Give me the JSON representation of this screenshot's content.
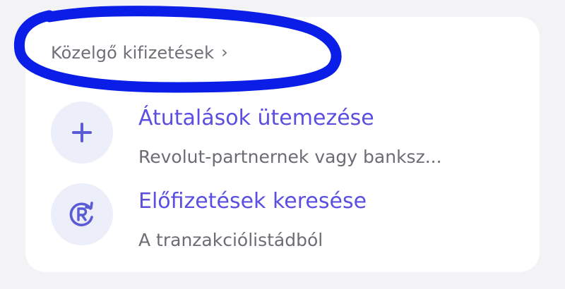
{
  "section": {
    "title": "Közelgő kifizetések",
    "chevron": "›"
  },
  "items": [
    {
      "title": "Átutalások ütemezése",
      "subtitle": "Revolut-partnernek vagy banksz...",
      "icon": "plus-icon"
    },
    {
      "title": "Előfizetések keresése",
      "subtitle": "A tranzakciólistádból",
      "icon": "recurring-registered-icon"
    }
  ],
  "colors": {
    "accent": "#5a4fe0",
    "icon_bg": "#eceef9",
    "annotation": "#0a1ee8",
    "page_bg": "#f3f3f6",
    "card_bg": "#ffffff",
    "muted_text": "#6c6c74"
  }
}
